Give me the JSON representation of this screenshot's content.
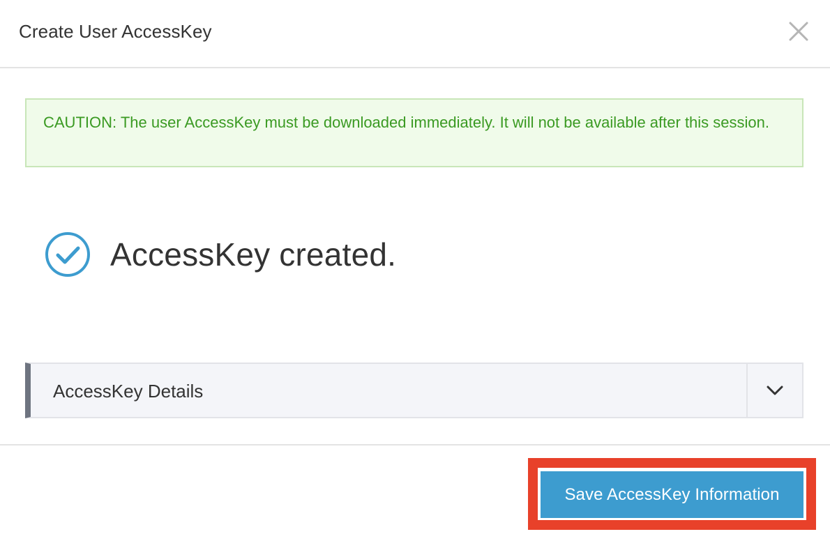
{
  "dialog": {
    "title": "Create User AccessKey",
    "close_icon": "close-icon"
  },
  "caution": {
    "text": "CAUTION: The user AccessKey must be downloaded immediately. It will not be available after this session."
  },
  "status": {
    "icon": "check-circle-icon",
    "message": "AccessKey created."
  },
  "details": {
    "label": "AccessKey Details",
    "toggle_icon": "chevron-down-icon"
  },
  "footer": {
    "save_label": "Save AccessKey Information"
  },
  "colors": {
    "caution_text": "#3a9a22",
    "caution_background": "#f0fbea",
    "check_icon": "#3d9ccf",
    "save_button": "#3d9ccf",
    "highlight_border": "#e8412a"
  }
}
